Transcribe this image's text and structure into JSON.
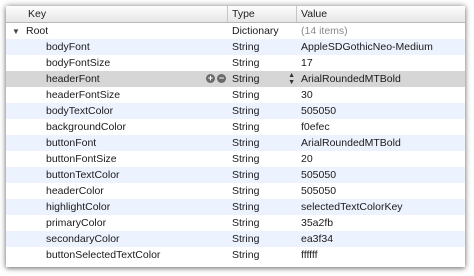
{
  "columns": {
    "key": "Key",
    "type": "Type",
    "value": "Value"
  },
  "rows": [
    {
      "key": "Root",
      "type": "Dictionary",
      "value": "(14 items)",
      "root": true
    },
    {
      "key": "bodyFont",
      "type": "String",
      "value": "AppleSDGothicNeo-Medium"
    },
    {
      "key": "bodyFontSize",
      "type": "String",
      "value": "17"
    },
    {
      "key": "headerFont",
      "type": "String",
      "value": "ArialRoundedMTBold",
      "selected": true
    },
    {
      "key": "headerFontSize",
      "type": "String",
      "value": "30"
    },
    {
      "key": "bodyTextColor",
      "type": "String",
      "value": "505050"
    },
    {
      "key": "backgroundColor",
      "type": "String",
      "value": "f0efec"
    },
    {
      "key": "buttonFont",
      "type": "String",
      "value": "ArialRoundedMTBold"
    },
    {
      "key": "buttonFontSize",
      "type": "String",
      "value": "20"
    },
    {
      "key": "buttonTextColor",
      "type": "String",
      "value": "505050"
    },
    {
      "key": "headerColor",
      "type": "String",
      "value": "505050"
    },
    {
      "key": "highlightColor",
      "type": "String",
      "value": "selectedTextColorKey"
    },
    {
      "key": "primaryColor",
      "type": "String",
      "value": "35a2fb"
    },
    {
      "key": "secondaryColor",
      "type": "String",
      "value": "ea3f34"
    },
    {
      "key": "buttonSelectedTextColor",
      "type": "String",
      "value": "ffffff"
    }
  ],
  "icons": {
    "disclosure": "disclosure-triangle-down-icon",
    "add": "add-row-icon",
    "remove": "remove-row-icon",
    "stepper": "type-stepper-icon"
  },
  "colors": {
    "alternate_row": "#edf3fe",
    "selected_row": "#d6d6d6",
    "muted_text": "#8a8a8a"
  }
}
